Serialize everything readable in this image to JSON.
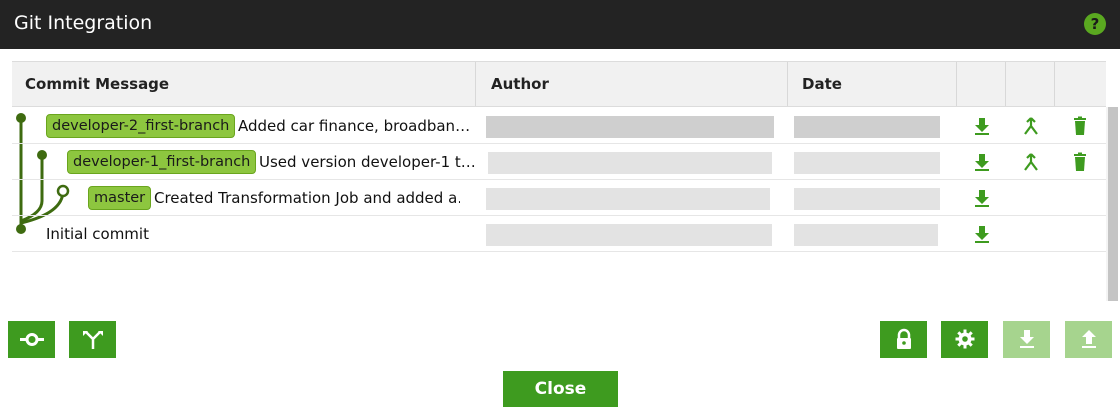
{
  "dialog": {
    "title": "Git Integration",
    "help_icon": "question-circle-icon",
    "accent_color": "#3e9b1f"
  },
  "columns": {
    "commit_message": "Commit Message",
    "author": "Author",
    "date": "Date"
  },
  "commits": [
    {
      "branch": "developer-2_first-branch",
      "message": "Added car finance, broadban…",
      "actions": [
        "download-icon",
        "merge-icon",
        "delete-icon"
      ]
    },
    {
      "branch": "developer-1_first-branch",
      "message": "Used version developer-1 t…",
      "actions": [
        "download-icon",
        "merge-icon",
        "delete-icon"
      ]
    },
    {
      "branch": "master",
      "message": "Created Transformation Job and added a…",
      "actions": [
        "download-icon"
      ]
    },
    {
      "branch": "",
      "message": "Initial commit",
      "actions": [
        "download-icon"
      ]
    }
  ],
  "toolbar": {
    "left": [
      "commit-icon",
      "branch-icon"
    ],
    "right": [
      "lock-icon",
      "settings-icon",
      "pull-icon",
      "push-icon"
    ]
  },
  "footer": {
    "close_label": "Close"
  }
}
